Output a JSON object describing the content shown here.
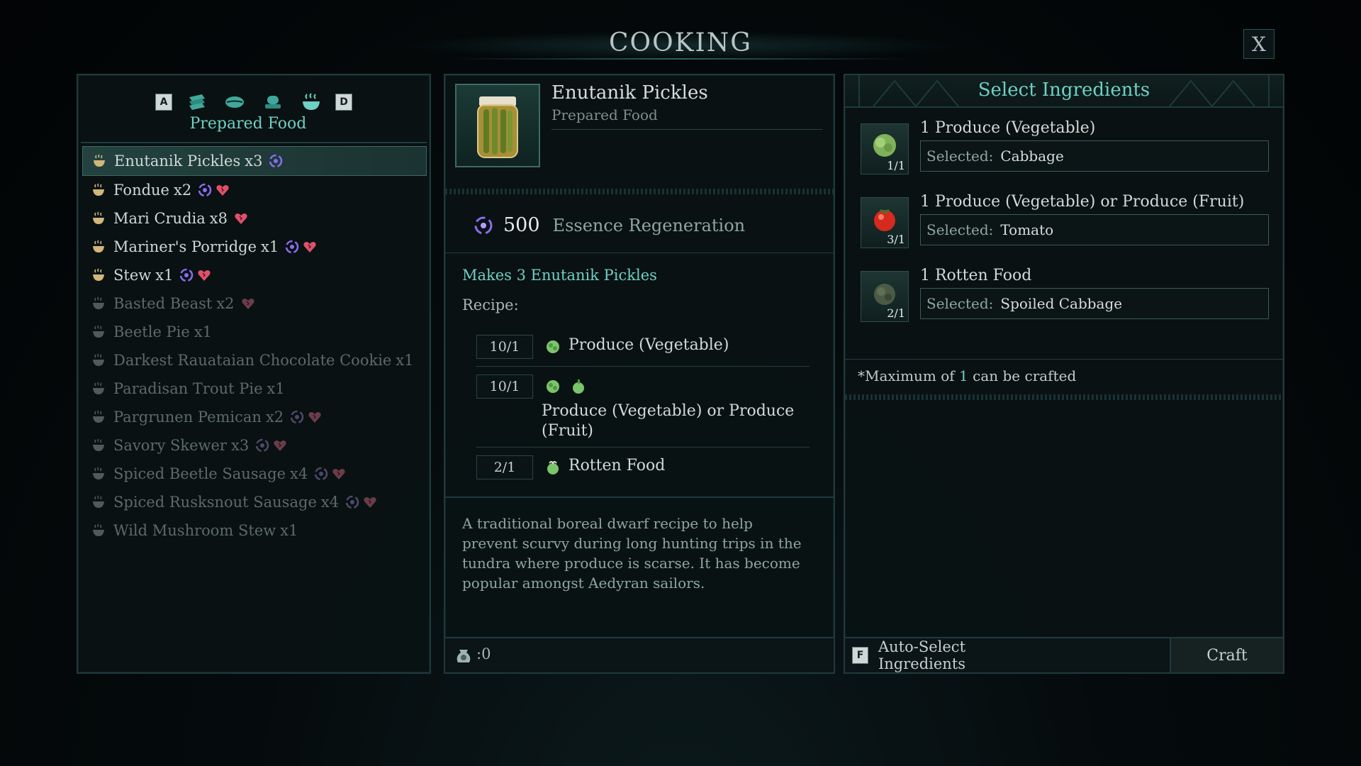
{
  "window": {
    "title": "COOKING",
    "close_label": "X"
  },
  "left": {
    "tab_keys": {
      "prev": "A",
      "next": "D"
    },
    "tab_icons": [
      "scroll-icon",
      "leaf-icon",
      "hat-icon",
      "cooking-pot-icon"
    ],
    "category": "Prepared Food",
    "recipes": [
      {
        "name": "Enutanik Pickles",
        "qty": "x3",
        "badges": [
          "essence"
        ],
        "available": true,
        "selected": true
      },
      {
        "name": "Fondue",
        "qty": "x2",
        "badges": [
          "essence",
          "health"
        ],
        "available": true
      },
      {
        "name": "Mari Crudia",
        "qty": "x8",
        "badges": [
          "health"
        ],
        "available": true
      },
      {
        "name": "Mariner's Porridge",
        "qty": "x1",
        "badges": [
          "essence",
          "health"
        ],
        "available": true
      },
      {
        "name": "Stew",
        "qty": "x1",
        "badges": [
          "essence",
          "health"
        ],
        "available": true
      },
      {
        "name": "Basted Beast",
        "qty": "x2",
        "badges": [
          "health"
        ],
        "available": false
      },
      {
        "name": "Beetle Pie",
        "qty": "x1",
        "badges": [],
        "available": false
      },
      {
        "name": "Darkest Rauataian Chocolate Cookie",
        "qty": "x1",
        "badges": [],
        "available": false
      },
      {
        "name": "Paradisan Trout Pie",
        "qty": "x1",
        "badges": [],
        "available": false
      },
      {
        "name": "Pargrunen Pemican",
        "qty": "x2",
        "badges": [
          "essence",
          "health"
        ],
        "available": false
      },
      {
        "name": "Savory Skewer",
        "qty": "x3",
        "badges": [
          "essence",
          "health"
        ],
        "available": false
      },
      {
        "name": "Spiced Beetle Sausage",
        "qty": "x4",
        "badges": [
          "essence",
          "health"
        ],
        "available": false
      },
      {
        "name": "Spiced Rusksnout Sausage",
        "qty": "x4",
        "badges": [
          "essence",
          "health"
        ],
        "available": false
      },
      {
        "name": "Wild Mushroom Stew",
        "qty": "x1",
        "badges": [],
        "available": false
      }
    ]
  },
  "detail": {
    "item_name": "Enutanik Pickles",
    "item_category": "Prepared Food",
    "essence_value": "500",
    "essence_label": "Essence Regeneration",
    "makes": "Makes 3 Enutanik Pickles",
    "recipe_label": "Recipe:",
    "requirements": [
      {
        "count": "10/1",
        "label": "Produce (Vegetable)"
      },
      {
        "count": "10/1",
        "label": "Produce (Vegetable) or Produce (Fruit)"
      },
      {
        "count": "2/1",
        "label": "Rotten Food"
      }
    ],
    "description": "A traditional boreal dwarf recipe to help prevent scurvy during long hunting trips in the tundra where produce is scarse. It has become popular amongst Aedyran sailors.",
    "footer_value": ":0"
  },
  "ingredients": {
    "title": "Select Ingredients",
    "selected_prefix": "Selected:",
    "slots": [
      {
        "requirement": "1 Produce (Vegetable)",
        "count": "1/1",
        "selected": "Cabbage",
        "thumb": "cabbage-icon"
      },
      {
        "requirement": "1 Produce (Vegetable) or Produce (Fruit)",
        "count": "3/1",
        "selected": "Tomato",
        "thumb": "tomato-icon"
      },
      {
        "requirement": "1 Rotten Food",
        "count": "2/1",
        "selected": "Spoiled Cabbage",
        "thumb": "spoiled-cabbage-icon"
      }
    ],
    "max_note_prefix": "*Maximum of ",
    "max_value": "1",
    "max_note_suffix": " can be crafted",
    "auto_key": "F",
    "auto_label": "Auto-Select Ingredients",
    "craft_label": "Craft"
  },
  "colors": {
    "accent": "#6fd0c4",
    "essence": "#8a6cf0",
    "health": "#e0506a",
    "border": "#1f3a3c"
  }
}
